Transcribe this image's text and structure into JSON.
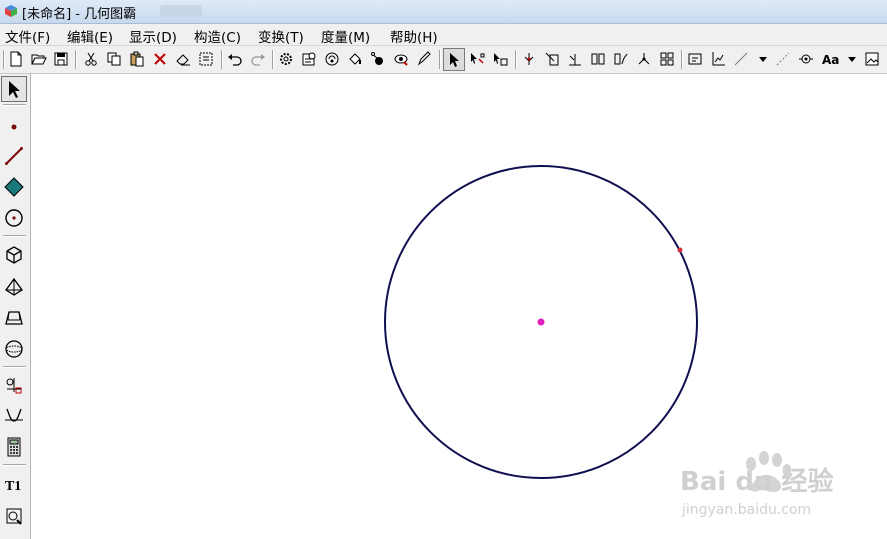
{
  "window": {
    "title": "[未命名] - 几何图霸"
  },
  "menu": {
    "items": [
      {
        "label": "文件(F)"
      },
      {
        "label": "编辑(E)"
      },
      {
        "label": "显示(D)"
      },
      {
        "label": "构造(C)"
      },
      {
        "label": "变换(T)"
      },
      {
        "label": "度量(M)"
      },
      {
        "label": "帮助(H)"
      }
    ]
  },
  "toolbar": {
    "font_button_label": "Aa"
  },
  "toolbox": {
    "text_tool_label": "T1"
  },
  "canvas": {
    "circle_stroke": "#101050",
    "center_point_color": "#e020c0",
    "edge_point_color": "#d03040"
  },
  "watermark": {
    "brand": "Bai du 经验",
    "url": "jingyan.baidu.com"
  }
}
